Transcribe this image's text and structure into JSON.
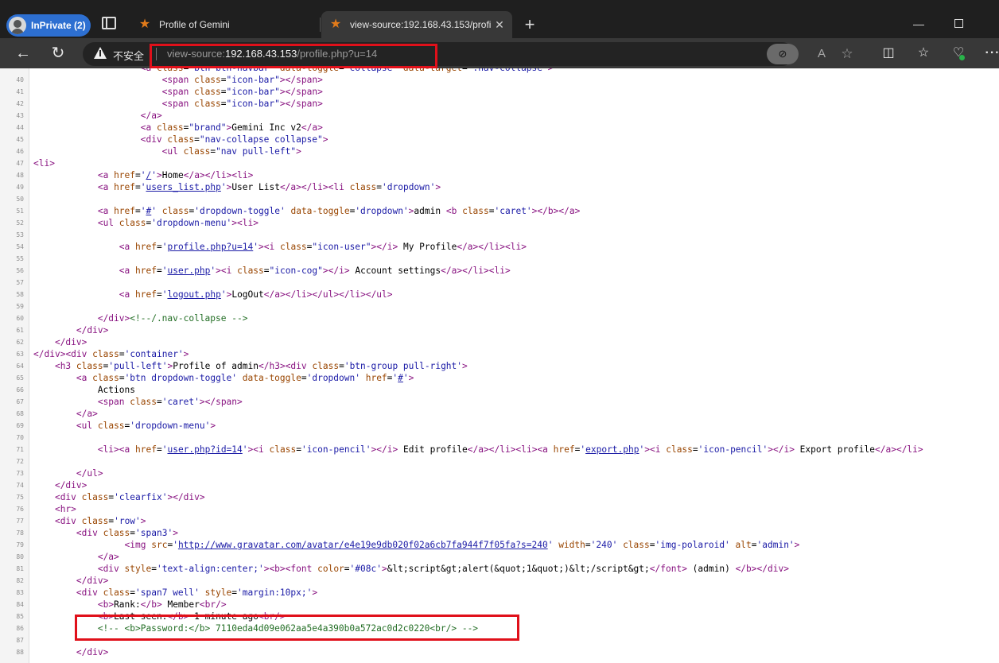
{
  "browser": {
    "inprivate_label": "InPrivate (2)",
    "tabs": [
      {
        "title": "Profile of Gemini",
        "active": false
      },
      {
        "title": "view-source:192.168.43.153/profi",
        "active": true
      }
    ],
    "address": {
      "security_label": "不安全",
      "scheme": "view-source:",
      "host": "192.168.43.153",
      "path": "/profile.php?u=14"
    },
    "icons": [
      "tab-actions-icon",
      "star-favicon",
      "close-icon",
      "new-tab-icon",
      "minimize-icon",
      "maximize-icon",
      "back-icon",
      "reload-icon",
      "warning-icon",
      "tracking-prevention-icon",
      "read-aloud-icon",
      "favorite-star-icon",
      "split-screen-icon",
      "favorites-icon",
      "browser-essentials-icon",
      "more-icon"
    ],
    "colors": {
      "highlight_box": "#e0101a",
      "inprivate_pill": "#2d6fd1"
    }
  },
  "source_lines": [
    {
      "n": "40",
      "code": "                        <span class=\"icon-bar\"></span>"
    },
    {
      "n": "41",
      "code": "                        <span class=\"icon-bar\"></span>"
    },
    {
      "n": "42",
      "code": "                        <span class=\"icon-bar\"></span>"
    },
    {
      "n": "43",
      "code": "                    </a>"
    },
    {
      "n": "44",
      "code": "                    <a class=\"brand\">Gemini Inc v2</a>"
    },
    {
      "n": "45",
      "code": "                    <div class=\"nav-collapse collapse\">"
    },
    {
      "n": "46",
      "code": "                        <ul class=\"nav pull-left\">"
    },
    {
      "n": "47",
      "code": "<li>"
    },
    {
      "n": "48",
      "code": "            <a href='/'>Home</a></li><li>"
    },
    {
      "n": "49",
      "code": "            <a href='users_list.php'>User List</a></li><li class='dropdown'>"
    },
    {
      "n": "50",
      "code": ""
    },
    {
      "n": "51",
      "code": "            <a href='#' class='dropdown-toggle' data-toggle='dropdown'>admin <b class='caret'></b></a>"
    },
    {
      "n": "52",
      "code": "            <ul class='dropdown-menu'><li>"
    },
    {
      "n": "53",
      "code": ""
    },
    {
      "n": "54",
      "code": "                <a href='profile.php?u=14'><i class=\"icon-user\"></i> My Profile</a></li><li>"
    },
    {
      "n": "55",
      "code": ""
    },
    {
      "n": "56",
      "code": "                <a href='user.php'><i class=\"icon-cog\"></i> Account settings</a></li><li>"
    },
    {
      "n": "57",
      "code": ""
    },
    {
      "n": "58",
      "code": "                <a href='logout.php'>LogOut</a></li></ul></li></ul>"
    },
    {
      "n": "59",
      "code": ""
    },
    {
      "n": "60",
      "code": "            </div><!--/.nav-collapse -->"
    },
    {
      "n": "61",
      "code": "        </div>"
    },
    {
      "n": "62",
      "code": "    </div>"
    },
    {
      "n": "63",
      "code": "</div><div class='container'>"
    },
    {
      "n": "64",
      "code": "    <h3 class='pull-left'>Profile of admin</h3><div class='btn-group pull-right'>"
    },
    {
      "n": "65",
      "code": "        <a class='btn dropdown-toggle' data-toggle='dropdown' href='#'>"
    },
    {
      "n": "66",
      "code": "            Actions"
    },
    {
      "n": "67",
      "code": "            <span class='caret'></span>"
    },
    {
      "n": "68",
      "code": "        </a>"
    },
    {
      "n": "69",
      "code": "        <ul class='dropdown-menu'>"
    },
    {
      "n": "70",
      "code": ""
    },
    {
      "n": "71",
      "code": "            <li><a href='user.php?id=14'><i class='icon-pencil'></i> Edit profile</a></li><li><a href='export.php'><i class='icon-pencil'></i> Export profile</a></li>"
    },
    {
      "n": "72",
      "code": ""
    },
    {
      "n": "73",
      "code": "        </ul>"
    },
    {
      "n": "74",
      "code": "    </div>"
    },
    {
      "n": "75",
      "code": "    <div class='clearfix'></div>"
    },
    {
      "n": "76",
      "code": "    <hr>"
    },
    {
      "n": "77",
      "code": "    <div class='row'>"
    },
    {
      "n": "78",
      "code": "        <div class='span3'>"
    },
    {
      "n": "79",
      "code": "                 <img src='http://www.gravatar.com/avatar/e4e19e9db020f02a6cb7fa944f7f05fa?s=240' width='240' class='img-polaroid' alt='admin'>"
    },
    {
      "n": "80",
      "code": "            </a>"
    },
    {
      "n": "81",
      "code": "            <div style='text-align:center;'><b><font color='#08c'>&lt;script&gt;alert(&quot;1&quot;)&lt;/script&gt;</font> (admin) </b></div>"
    },
    {
      "n": "82",
      "code": "        </div>"
    },
    {
      "n": "83",
      "code": "        <div class='span7 well' style='margin:10px;'>"
    },
    {
      "n": "84",
      "code": "            <b>Rank:</b> Member<br/>"
    },
    {
      "n": "85",
      "code": "            <b>Last seen:</b> 1 minute ago<br/>"
    },
    {
      "n": "86",
      "code": "            <!-- <b>Password:</b> 7110eda4d09e062aa5e4a390b0a572ac0d2c0220<br/> -->"
    },
    {
      "n": "87",
      "code": ""
    },
    {
      "n": "88",
      "code": "        </div>"
    }
  ],
  "top_partial_line": "                    <a class=\"btn btn-navbar\" data-toggle=\"collapse\" data-target=\".nav-collapse\">",
  "link_values": [
    "/",
    "users_list.php",
    "#",
    "profile.php?u=14",
    "user.php",
    "logout.php",
    "user.php?id=14",
    "export.php",
    "http://www.gravatar.com/avatar/e4e19e9db020f02a6cb7fa944f7f05fa?s=240"
  ]
}
